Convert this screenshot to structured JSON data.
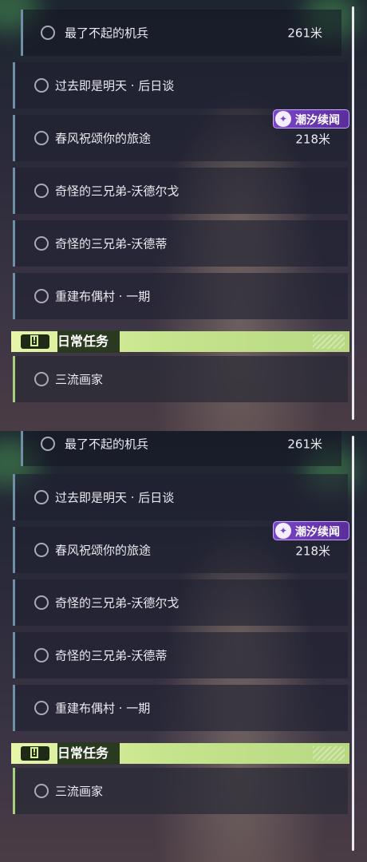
{
  "colors": {
    "quest_accent": "#6f8fa4",
    "daily_accent": "#a6d07c",
    "badge_purple": "#7a45c9",
    "daily_header": "#d6eea0"
  },
  "panels": [
    {
      "quests": [
        {
          "title": "最了不起的机兵",
          "distance": "261米"
        },
        {
          "title": "过去即是明天 · 后日谈",
          "distance": ""
        },
        {
          "title": "春风祝颂你的旅途",
          "distance": "218米",
          "badge": "潮汐续闻"
        },
        {
          "title": "奇怪的三兄弟-沃德尔戈",
          "distance": ""
        },
        {
          "title": "奇怪的三兄弟-沃德蒂",
          "distance": ""
        },
        {
          "title": "重建布偶村 · 一期",
          "distance": ""
        }
      ],
      "daily": {
        "header": "日常任务",
        "items": [
          {
            "title": "三流画家"
          }
        ]
      }
    },
    {
      "quests": [
        {
          "title": "最了不起的机兵",
          "distance": "261米"
        },
        {
          "title": "过去即是明天 · 后日谈",
          "distance": ""
        },
        {
          "title": "春风祝颂你的旅途",
          "distance": "218米",
          "badge": "潮汐续闻"
        },
        {
          "title": "奇怪的三兄弟-沃德尔戈",
          "distance": ""
        },
        {
          "title": "奇怪的三兄弟-沃德蒂",
          "distance": ""
        },
        {
          "title": "重建布偶村 · 一期",
          "distance": ""
        }
      ],
      "daily": {
        "header": "日常任务",
        "items": [
          {
            "title": "三流画家"
          }
        ]
      }
    }
  ]
}
